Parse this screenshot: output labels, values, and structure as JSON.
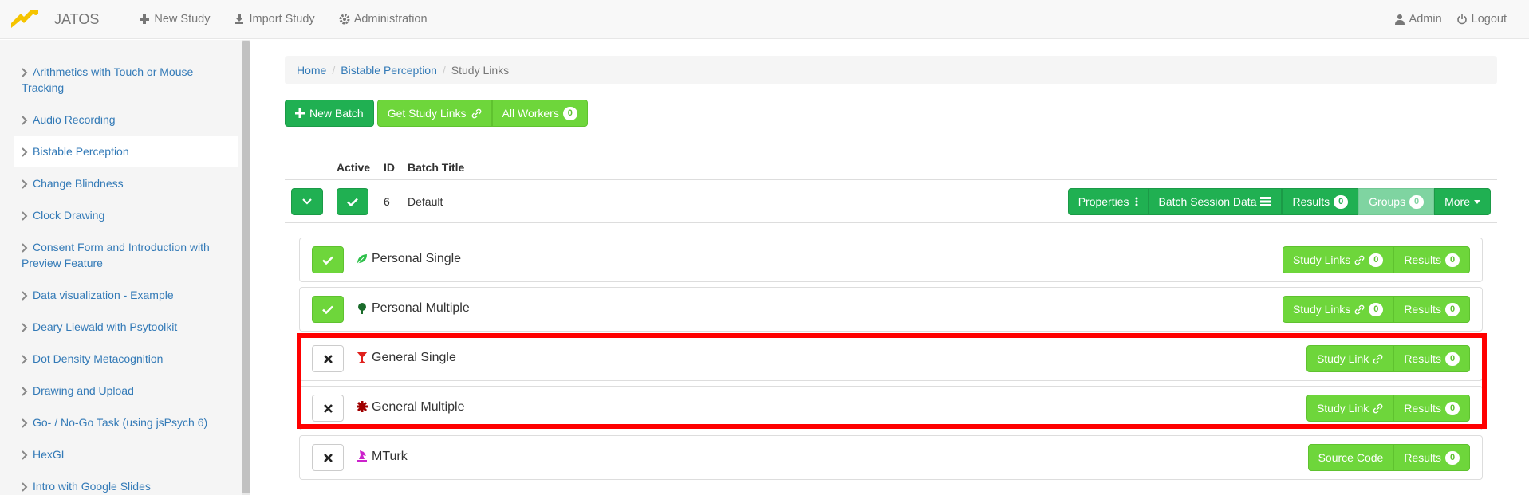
{
  "navbar": {
    "brand": "JATOS",
    "new_study": "New Study",
    "import_study": "Import Study",
    "administration": "Administration",
    "user": "Admin",
    "logout": "Logout"
  },
  "sidebar": {
    "items": [
      {
        "label": "Arithmetics with Touch or Mouse Tracking"
      },
      {
        "label": "Audio Recording"
      },
      {
        "label": "Bistable Perception"
      },
      {
        "label": "Change Blindness"
      },
      {
        "label": "Clock Drawing"
      },
      {
        "label": "Consent Form and Introduction with Preview Feature"
      },
      {
        "label": "Data visualization - Example"
      },
      {
        "label": "Deary Liewald with Psytoolkit"
      },
      {
        "label": "Dot Density Metacognition"
      },
      {
        "label": "Drawing and Upload"
      },
      {
        "label": "Go- / No-Go Task (using jsPsych 6)"
      },
      {
        "label": "HexGL"
      },
      {
        "label": "Intro with Google Slides"
      }
    ]
  },
  "breadcrumb": {
    "home": "Home",
    "study": "Bistable Perception",
    "current": "Study Links"
  },
  "toolbar": {
    "new_batch": "New Batch",
    "get_study_links": "Get Study Links",
    "all_workers": "All Workers",
    "all_workers_count": "0"
  },
  "table": {
    "col_active": "Active",
    "col_id": "ID",
    "col_title": "Batch Title"
  },
  "batch": {
    "id": "6",
    "title": "Default",
    "properties": "Properties",
    "batch_session_data": "Batch Session Data",
    "results": "Results",
    "results_count": "0",
    "groups": "Groups",
    "groups_count": "0",
    "more": "More"
  },
  "worker_types": [
    {
      "label": "Personal Single",
      "link_label": "Study Links",
      "link_count": "0",
      "results": "Results",
      "results_count": "0",
      "enabled": true,
      "icon": "leaf-icon"
    },
    {
      "label": "Personal Multiple",
      "link_label": "Study Links",
      "link_count": "0",
      "results": "Results",
      "results_count": "0",
      "enabled": true,
      "icon": "tree-icon"
    },
    {
      "label": "General Single",
      "link_label": "Study Link",
      "results": "Results",
      "results_count": "0",
      "enabled": false,
      "icon": "glass-icon"
    },
    {
      "label": "General Multiple",
      "link_label": "Study Link",
      "results": "Results",
      "results_count": "0",
      "enabled": false,
      "icon": "asterisk-icon"
    },
    {
      "label": "MTurk",
      "link_label": "Source Code",
      "results": "Results",
      "results_count": "0",
      "enabled": false,
      "icon": "chess-icon"
    }
  ],
  "colors": {
    "dark_green": "#20b052",
    "light_green": "#6ed63b",
    "link_blue": "#337ab7",
    "highlight": "#ff0000"
  }
}
